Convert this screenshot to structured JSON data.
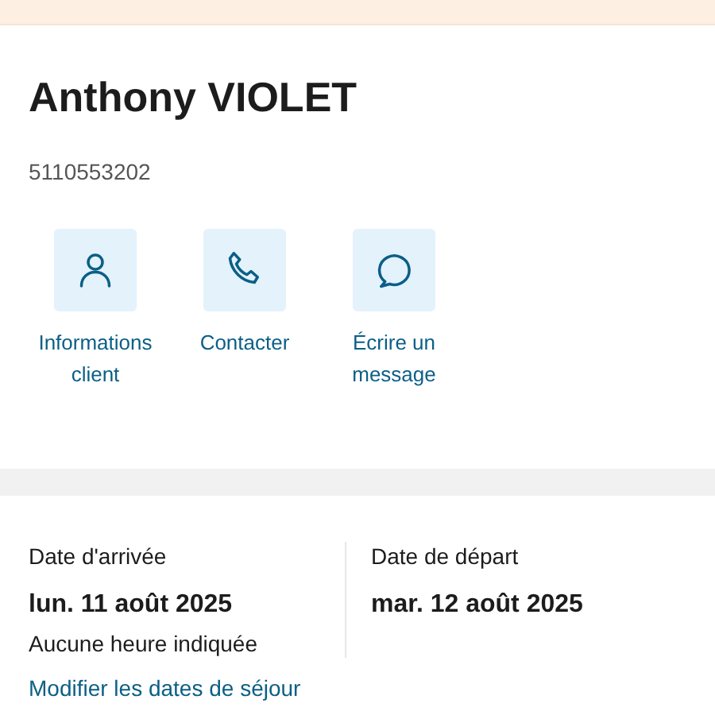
{
  "customer": {
    "name": "Anthony VIOLET",
    "number": "5110553202"
  },
  "actions": [
    {
      "kind": "person",
      "label": "Informations client"
    },
    {
      "kind": "phone",
      "label": "Contacter"
    },
    {
      "kind": "chat",
      "label": "Écrire un message"
    }
  ],
  "stay": {
    "arrival": {
      "label": "Date d'arrivée",
      "date": "lun. 11 août 2025",
      "note": "Aucune heure indiquée"
    },
    "departure": {
      "label": "Date de départ",
      "date": "mar. 12 août 2025"
    },
    "link": "Modifier les dates de séjour"
  }
}
